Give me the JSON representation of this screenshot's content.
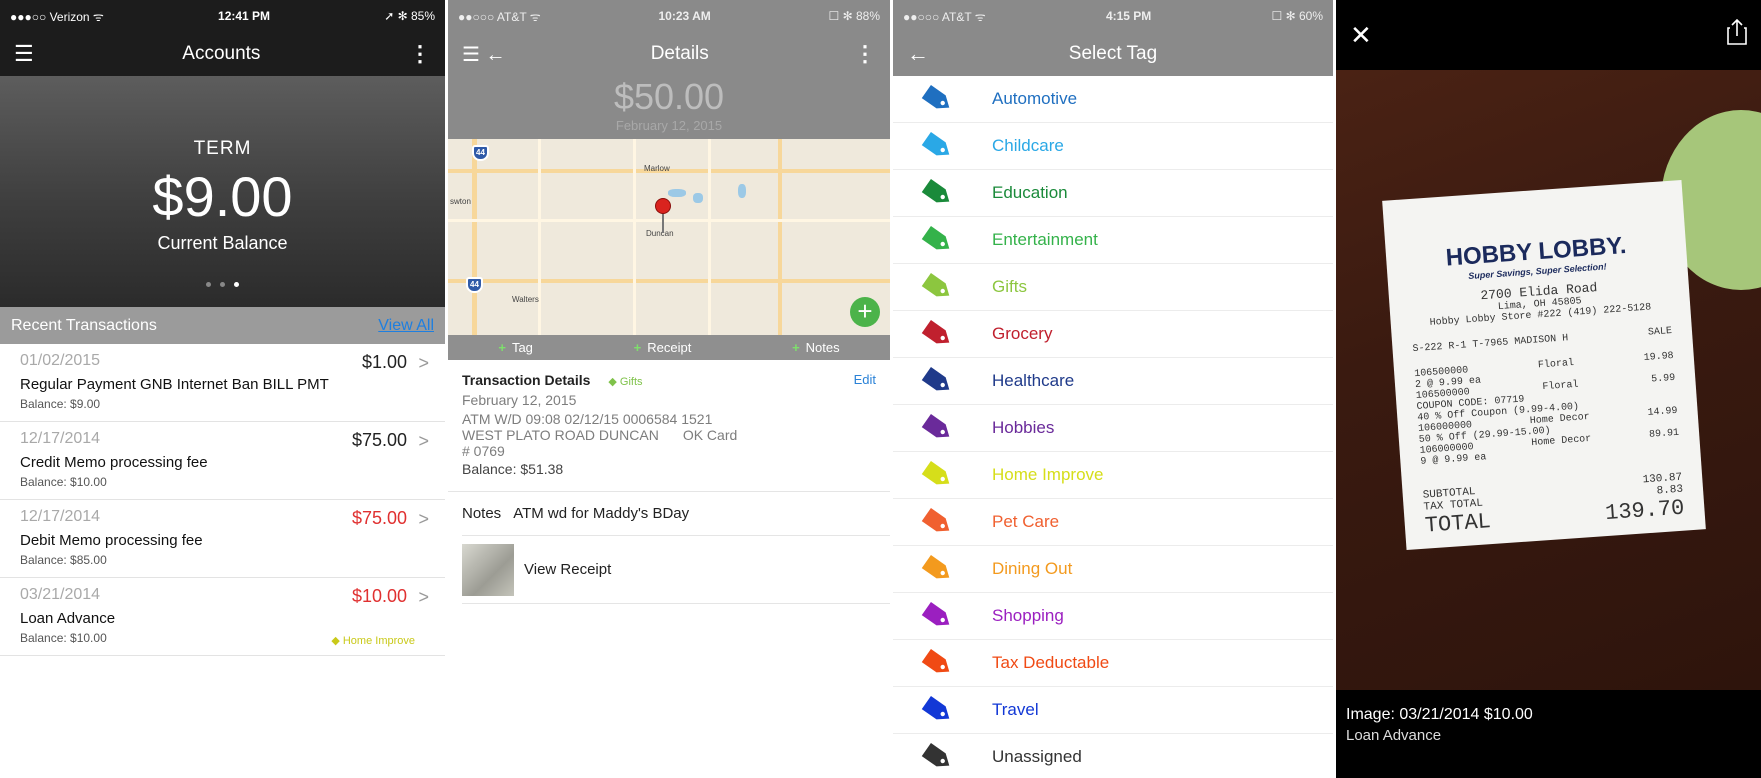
{
  "screen1": {
    "status": {
      "carrier": "●●●○○ Verizon ᯤ",
      "time": "12:41 PM",
      "battery": "➚ ✻ 85%"
    },
    "nav": {
      "title": "Accounts"
    },
    "hero": {
      "account_type": "TERM",
      "balance": "$9.00",
      "balance_label": "Current Balance"
    },
    "recent_header": "Recent Transactions",
    "view_all": "View All",
    "transactions": [
      {
        "date": "01/02/2015",
        "description": "Regular Payment GNB Internet Ban BILL PMT",
        "balance": "Balance: $9.00",
        "amount": "$1.00",
        "negative": false,
        "tag": ""
      },
      {
        "date": "12/17/2014",
        "description": "Credit Memo processing fee",
        "balance": "Balance: $10.00",
        "amount": "$75.00",
        "negative": false,
        "tag": ""
      },
      {
        "date": "12/17/2014",
        "description": "Debit Memo processing fee",
        "balance": "Balance: $85.00",
        "amount": "$75.00",
        "negative": true,
        "tag": ""
      },
      {
        "date": "03/21/2014",
        "description": "Loan Advance",
        "balance": "Balance: $10.00",
        "amount": "$10.00",
        "negative": true,
        "tag": "Home Improve"
      }
    ]
  },
  "screen2": {
    "status": {
      "carrier": "●●○○○ AT&T ᯤ",
      "time": "10:23 AM",
      "battery": "☐ ✻ 88%"
    },
    "nav": {
      "title": "Details"
    },
    "amount": "$50.00",
    "date": "February 12, 2015",
    "map": {
      "towns": [
        "Marlow",
        "swton",
        "Duncan",
        "Walters"
      ],
      "interstates": [
        "44",
        "44"
      ]
    },
    "actions": [
      "Tag",
      "Receipt",
      "Notes"
    ],
    "details": {
      "title": "Transaction Details",
      "tag": "Gifts",
      "edit": "Edit",
      "date": "February 12, 2015",
      "line1": "ATM W/D 09:08 02/12/15 0006584 1521",
      "line2a": "WEST PLATO ROAD DUNCAN",
      "line2b": "OK Card",
      "line3": "# 0769",
      "balance": "Balance: $51.38"
    },
    "notes": {
      "label": "Notes",
      "text": "ATM wd for Maddy's BDay"
    },
    "receipt_label": "View Receipt"
  },
  "screen3": {
    "status": {
      "carrier": "●●○○○ AT&T ᯤ",
      "time": "4:15 PM",
      "battery": "☐ ✻ 60%"
    },
    "nav": {
      "title": "Select Tag"
    },
    "tags": [
      {
        "label": "Automotive",
        "color": "#1f6fc0"
      },
      {
        "label": "Childcare",
        "color": "#2aa8e6"
      },
      {
        "label": "Education",
        "color": "#1a8a3a"
      },
      {
        "label": "Entertainment",
        "color": "#34b24a"
      },
      {
        "label": "Gifts",
        "color": "#8cc63f"
      },
      {
        "label": "Grocery",
        "color": "#c0202e"
      },
      {
        "label": "Healthcare",
        "color": "#1f3a8a"
      },
      {
        "label": "Hobbies",
        "color": "#6a2a9a"
      },
      {
        "label": "Home Improve",
        "color": "#d6de1a"
      },
      {
        "label": "Pet Care",
        "color": "#f06030"
      },
      {
        "label": "Dining Out",
        "color": "#f39a1e"
      },
      {
        "label": "Shopping",
        "color": "#9b1fc0"
      },
      {
        "label": "Tax Deductable",
        "color": "#f04a14"
      },
      {
        "label": "Travel",
        "color": "#1238d6"
      },
      {
        "label": "Unassigned",
        "color": "#333333"
      }
    ]
  },
  "screen4": {
    "receipt": {
      "brand": "HOBBY LOBBY.",
      "slogan": "Super Savings, Super Selection!",
      "address1": "2700 Elida Road",
      "address2": "Lima, OH 45805",
      "store": "Hobby Lobby Store #222 (419) 222-5128",
      "reg": "S-222 R-1 T-7965 MADISON H",
      "sale": "SALE",
      "items": [
        {
          "left": "106500000",
          "mid": "Floral",
          "right": "19.98"
        },
        {
          "left": " 2 @ 9.99 ea",
          "mid": "",
          "right": ""
        },
        {
          "left": "106500000",
          "mid": "Floral",
          "right": "5.99"
        },
        {
          "left": "COUPON CODE: 07719",
          "mid": "",
          "right": ""
        },
        {
          "left": "40 % Off Coupon (9.99-4.00)",
          "mid": "",
          "right": ""
        },
        {
          "left": "106000000",
          "mid": "Home Decor",
          "right": "14.99"
        },
        {
          "left": "50 % Off  (29.99-15.00)",
          "mid": "",
          "right": ""
        },
        {
          "left": "106000000",
          "mid": "Home Decor",
          "right": "89.91"
        },
        {
          "left": " 9 @ 9.99 ea",
          "mid": "",
          "right": ""
        }
      ],
      "subtotal_label": "SUBTOTAL",
      "subtotal": "130.87",
      "tax_label": "TAX TOTAL",
      "tax": "8.83",
      "total_label": "TOTAL",
      "total": "139.70"
    },
    "caption1": "Image: 03/21/2014 $10.00",
    "caption2": "Loan Advance"
  }
}
